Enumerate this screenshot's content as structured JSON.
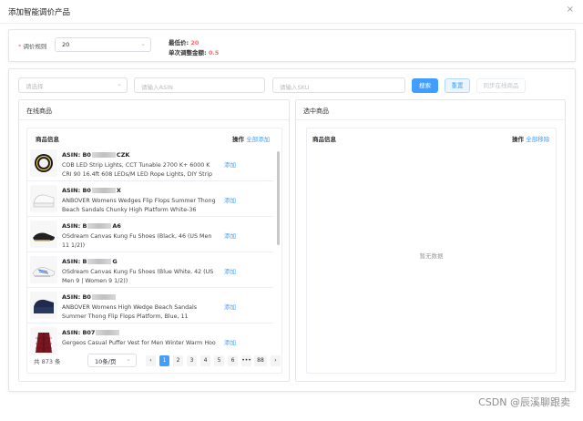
{
  "dialog": {
    "title": "添加智能调价产品",
    "close_glyph": "×"
  },
  "rule": {
    "required_mark": "*",
    "label": "调价规则",
    "selected": "20",
    "min_price_label": "最低价:",
    "min_price_value": "20",
    "max_adjust_label": "单次调整金额:",
    "max_adjust_value": "0.5"
  },
  "filters": {
    "select_placeholder": "请选择",
    "asin_placeholder": "请输入ASIN",
    "sku_placeholder": "请输入SKU",
    "search_label": "搜索",
    "reset_label": "重置",
    "sync_label": "同步在线商品"
  },
  "left_panel": {
    "title": "在线商品",
    "col_info": "商品信息",
    "col_op": "操作",
    "add_all": "全部添加",
    "add_label": "添加",
    "rows": [
      {
        "asin_label": "ASIN:",
        "asin_prefix": "B0",
        "asin_suffix": "CZK",
        "title": "COB LED Strip Lights, CCT Tunable 2700 K+ 6000 K CRI 90 16.4ft 608 LEDs/M LED Rope Lights, DIY Strip Ligh..."
      },
      {
        "asin_label": "ASIN:",
        "asin_prefix": "B0",
        "asin_suffix": "X",
        "title": "ANBOVER Womens Wedges Flip Flops Summer Thong Beach Sandals Chunky High Platform White-36"
      },
      {
        "asin_label": "ASIN:",
        "asin_prefix": "B",
        "asin_suffix": "A6",
        "title": "OSdream Canvas Kung Fu Shoes (Black, 46 (US Men 11 1/2))"
      },
      {
        "asin_label": "ASIN:",
        "asin_prefix": "B",
        "asin_suffix": "G",
        "title": "OSdream Canvas Kung Fu Shoes (Blue White, 42 (US Men 9 | Women 9 1/2))"
      },
      {
        "asin_label": "ASIN:",
        "asin_prefix": "B0",
        "asin_suffix": "",
        "title": "ANBOVER Womens High Wedge Beach Sandals Summer Thong Flip Flops Platform, Blue, 11"
      },
      {
        "asin_label": "ASIN:",
        "asin_prefix": "B07",
        "asin_suffix": "",
        "title": "Gergeos Casual Puffer Vest for Men Winter Warm Hoo"
      }
    ],
    "pager": {
      "total": "共 873 条",
      "page_size": "10条/页",
      "prev": "‹",
      "next": "›",
      "pages": [
        "1",
        "2",
        "3",
        "4",
        "5",
        "6",
        "•••",
        "88"
      ],
      "active": "1"
    }
  },
  "right_panel": {
    "title": "选中商品",
    "col_info": "商品信息",
    "col_op": "操作",
    "remove_all": "全部移除",
    "empty_text": "暂无数据"
  },
  "watermark": "CSDN @辰溪聊跟卖",
  "colors": {
    "primary": "#409eff",
    "danger": "#f56c6c"
  },
  "icons": {
    "close": "close-icon",
    "chevron": "chevron-down-icon"
  }
}
